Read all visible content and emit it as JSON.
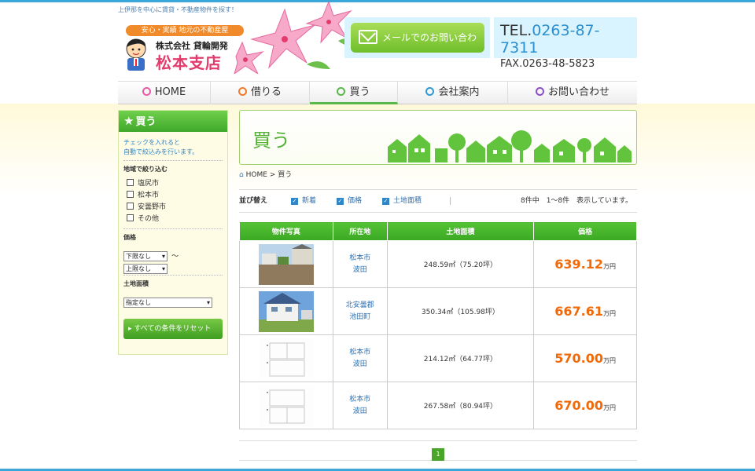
{
  "header": {
    "tagline": "上伊那を中心に賃貸・不動産物件を探す！",
    "logo_badge": "安心・実績 地元の不動産屋",
    "company": "株式会社 貸輪開発",
    "branch": "松本支店",
    "mail_button": "メールでのお問い合わせ",
    "tel_prefix": "TEL.",
    "tel_number": "0263-87-7311",
    "fax": "FAX.0263-48-5823"
  },
  "nav": [
    {
      "label": "HOME",
      "dot_color": "#e85aa6"
    },
    {
      "label": "借りる",
      "dot_color": "#f07a2a"
    },
    {
      "label": "買う",
      "dot_color": "#58b848"
    },
    {
      "label": "会社案内",
      "dot_color": "#2f9ad8"
    },
    {
      "label": "お問い合わせ",
      "dot_color": "#8a4fc8"
    }
  ],
  "sidebar": {
    "title": "買う",
    "note_line1": "チェックを入れると",
    "note_line2": "自動で絞込みを行います。",
    "area_title": "地域で絞り込む",
    "areas": [
      "塩尻市",
      "松本市",
      "安曇野市",
      "その他"
    ],
    "price_title": "価格",
    "price_min": "下限なし",
    "price_tilde": "〜",
    "price_max": "上限なし",
    "land_title": "土地面積",
    "land_select": "指定なし",
    "reset_button": "すべての条件をリセット"
  },
  "main": {
    "page_title": "買う",
    "breadcrumb_home": "HOME",
    "breadcrumb_sep": ">",
    "breadcrumb_current": "買う",
    "sort_label": "並び替え",
    "sort_options": [
      "新着",
      "価格",
      "土地面積"
    ],
    "count_text": "8件中　1〜8件　表示しています。",
    "columns": [
      "物件写真",
      "所在地",
      "土地面積",
      "価格"
    ],
    "rows": [
      {
        "loc1": "松本市",
        "loc2": "波田",
        "area": "248.59㎡（75.20坪）",
        "price": "639.12",
        "unit": "万円",
        "photo": "lot"
      },
      {
        "loc1": "北安曇郡",
        "loc2": "池田町",
        "area": "350.34㎡（105.98坪）",
        "price": "667.61",
        "unit": "万円",
        "photo": "house"
      },
      {
        "loc1": "松本市",
        "loc2": "波田",
        "area": "214.12㎡（64.77坪）",
        "price": "570.00",
        "unit": "万円",
        "photo": "plan"
      },
      {
        "loc1": "松本市",
        "loc2": "波田",
        "area": "267.58㎡（80.94坪）",
        "price": "670.00",
        "unit": "万円",
        "photo": "plan"
      }
    ],
    "page_number": "1"
  }
}
